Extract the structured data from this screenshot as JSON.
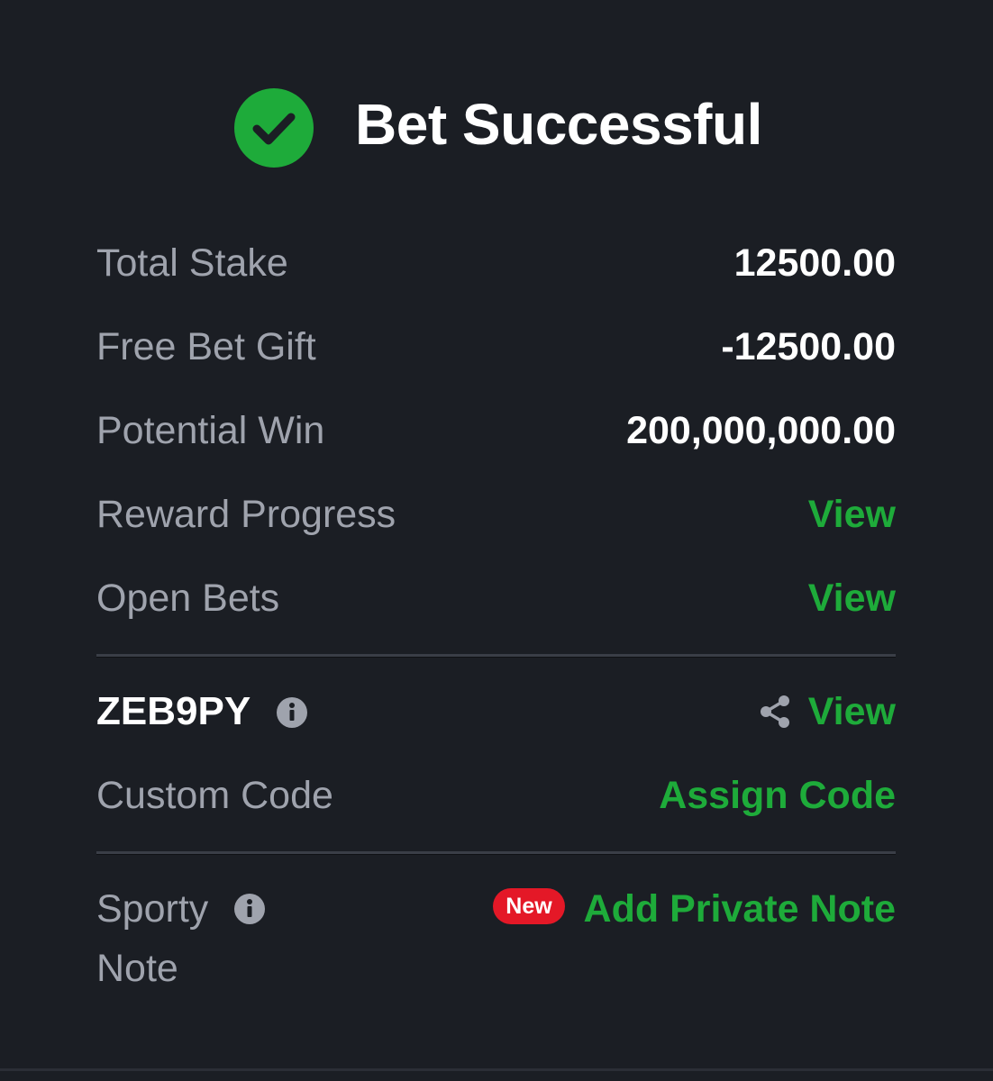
{
  "header": {
    "title": "Bet Successful",
    "icon": "check-circle-icon",
    "icon_color": "#1eab3a"
  },
  "summary": {
    "total_stake_label": "Total Stake",
    "total_stake_value": "12500.00",
    "free_bet_label": "Free Bet Gift",
    "free_bet_value": "-12500.00",
    "potential_win_label": "Potential Win",
    "potential_win_value": "200,000,000.00",
    "reward_progress_label": "Reward Progress",
    "reward_progress_link": "View",
    "open_bets_label": "Open Bets",
    "open_bets_link": "View"
  },
  "booking": {
    "code": "ZEB9PY",
    "info_icon": "info-icon",
    "share_icon": "share-icon",
    "view_link": "View",
    "custom_code_label": "Custom Code",
    "assign_code_link": "Assign Code"
  },
  "note": {
    "label_line1": "Sporty",
    "label_line2": "Note",
    "info_icon": "info-icon",
    "badge": "New",
    "badge_color": "#e41827",
    "add_note_link": "Add Private Note"
  },
  "colors": {
    "background": "#1b1e24",
    "accent_green": "#1eab3a",
    "label_gray": "#9fa3ad",
    "value_white": "#ffffff"
  }
}
